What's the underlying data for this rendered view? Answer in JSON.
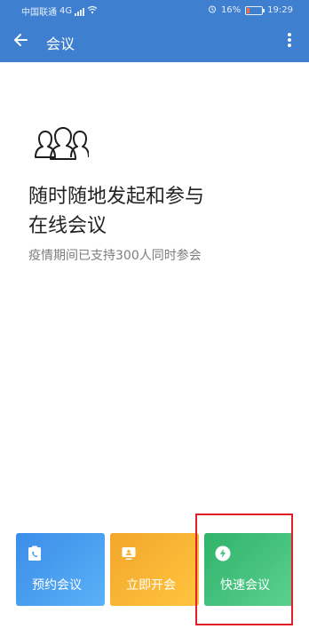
{
  "status_bar": {
    "carrier": "中国联通",
    "network": "4G",
    "battery": "16%",
    "time": "19:29"
  },
  "app_bar": {
    "title": "会议",
    "back_icon": "arrow-left-icon",
    "more_icon": "more-vert-icon"
  },
  "hero": {
    "icon": "people-group-icon",
    "headline_line1": "随时随地发起和参与",
    "headline_line2": "在线会议",
    "subtext": "疫情期间已支持300人同时参会"
  },
  "actions": [
    {
      "label": "预约会议",
      "icon": "phone-clipboard-icon"
    },
    {
      "label": "立即开会",
      "icon": "screen-person-icon"
    },
    {
      "label": "快速会议",
      "icon": "lightning-icon"
    }
  ],
  "colors": {
    "header": "#3f7fcf",
    "card_appoint": "#4b9ff0",
    "card_instant": "#f8b437",
    "card_quick": "#45c37c",
    "highlight": "#e21f26"
  }
}
